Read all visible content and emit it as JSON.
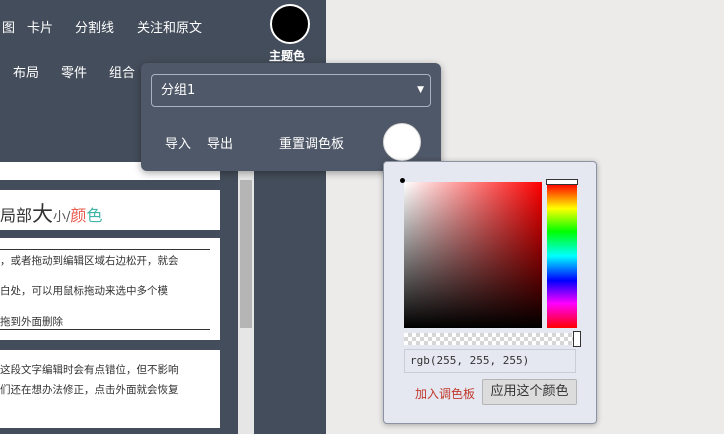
{
  "nav": {
    "row1": [
      "图",
      "卡片",
      "分割线",
      "关注和原文"
    ],
    "row2": [
      "布局",
      "零件",
      "组合"
    ]
  },
  "theme": {
    "label": "主题色",
    "color": "#000000"
  },
  "content": {
    "title": {
      "part1": "局部",
      "big": "大",
      "small": "小",
      "slash": "/",
      "color1": "颜",
      "color2": "色"
    },
    "text_block": {
      "line1": "，或者拖动到编辑区域右边松开，就会",
      "line2": "白处，可以用鼠标拖动来选中多个模",
      "line3": "拖到外面删除"
    },
    "text_block2": {
      "line1": "这段文字编辑时会有点错位，但不影响",
      "line2": "们还在想办法修正，点击外面就会恢复"
    }
  },
  "group_panel": {
    "selected_group": "分组1",
    "import_label": "导入",
    "export_label": "导出",
    "reset_label": "重置调色板",
    "swatch_color": "#ffffff"
  },
  "picker": {
    "value": "rgb(255, 255, 255)",
    "add_label": "加入调色板",
    "apply_label": "应用这个颜色"
  },
  "colors": {
    "panel_bg": "#444d5b",
    "popup_bg": "#4f5868",
    "picker_bg": "#e5e8f1",
    "accent_red": "#e8584b",
    "accent_teal": "#3fb5a6"
  }
}
